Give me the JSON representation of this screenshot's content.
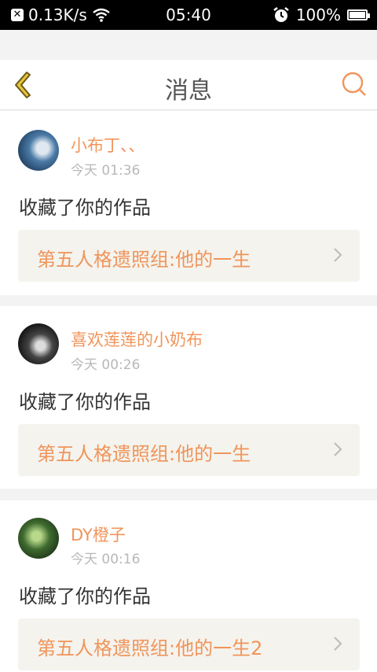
{
  "status_bar": {
    "network_speed": "0.13K/s",
    "time": "05:40",
    "battery_percent": "100%",
    "battery_level": 1.0,
    "icons": [
      "notification-x-icon",
      "wifi-icon",
      "alarm-icon",
      "battery-icon"
    ]
  },
  "header": {
    "title": "消息"
  },
  "colors": {
    "accent": "#f0955a",
    "back_icon_fill": "#e8c33a",
    "back_icon_stroke": "#6b5a1a",
    "time_text": "#b8b8b8"
  },
  "messages": [
    {
      "user": "小布丁、、",
      "time": "今天 01:36",
      "action": "收藏了你的作品",
      "work_title": "第五人格遗照组:他的一生"
    },
    {
      "user": "喜欢莲莲的小奶布",
      "time": "今天 00:26",
      "action": "收藏了你的作品",
      "work_title": "第五人格遗照组:他的一生"
    },
    {
      "user": "DY橙子",
      "time": "今天 00:16",
      "action": "收藏了你的作品",
      "work_title": "第五人格遗照组:他的一生2"
    }
  ]
}
